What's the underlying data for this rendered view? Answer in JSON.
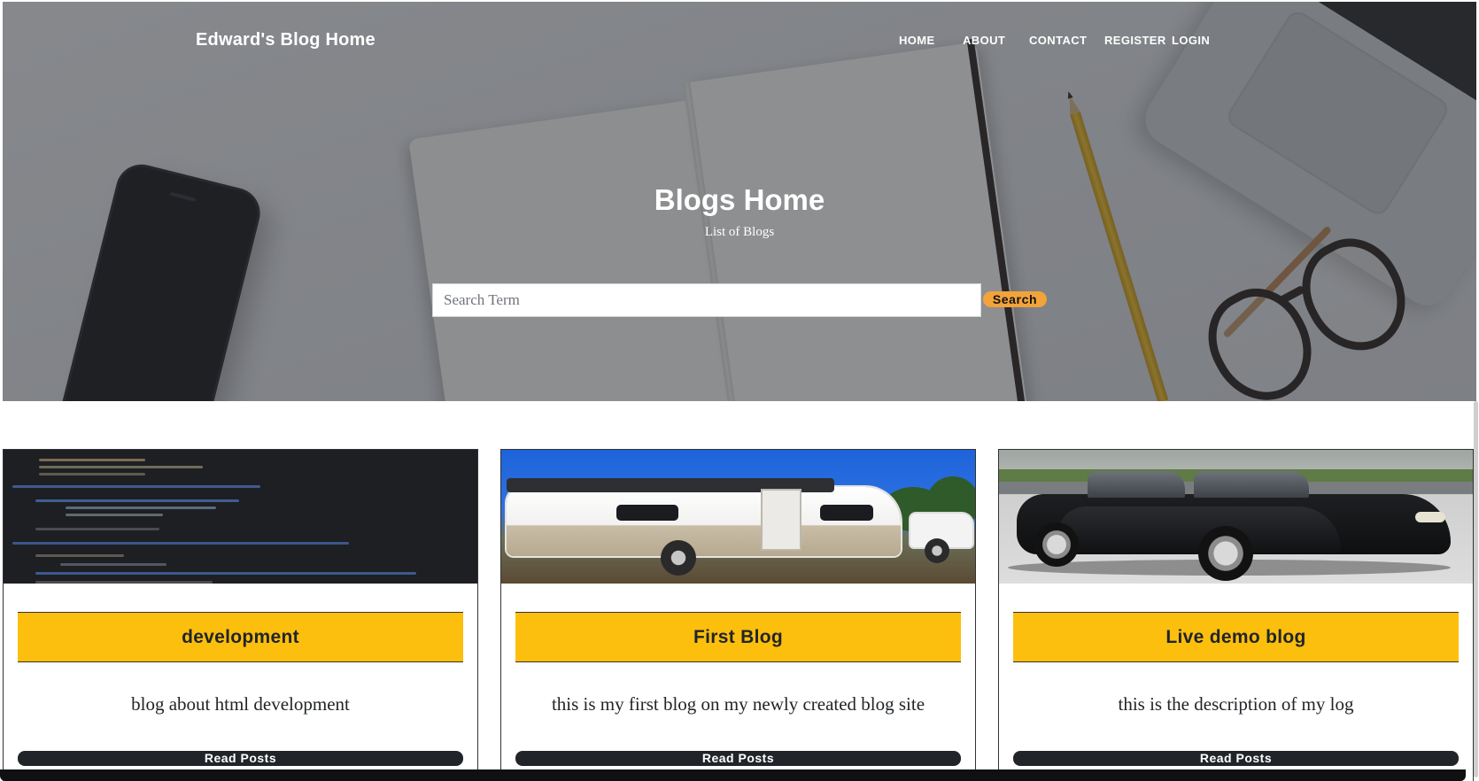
{
  "navbar": {
    "brand": "Edward's Blog Home",
    "links": [
      "Home",
      "About",
      "Contact",
      "Register",
      "Login"
    ]
  },
  "hero": {
    "title": "Blogs Home",
    "subtitle": "List of Blogs"
  },
  "search": {
    "placeholder": "Search Term",
    "button_label": "Search",
    "button_color": "#f2a33a"
  },
  "blogs": [
    {
      "title": "development",
      "description": "blog about html development",
      "button_label": "Read Posts",
      "image_icon": "code-screenshot-image"
    },
    {
      "title": "First Blog",
      "description": "this is my first blog on my newly created blog site",
      "button_label": "Read Posts",
      "image_icon": "camper-trailer-image"
    },
    {
      "title": "Live demo blog",
      "description": "this is the description of my log",
      "button_label": "Read Posts",
      "image_icon": "black-car-image"
    }
  ],
  "colors": {
    "title_bar": "#fdbf0d",
    "read_button": "#212529",
    "hero_overlay": "rgba(35,37,41,0.5)"
  }
}
